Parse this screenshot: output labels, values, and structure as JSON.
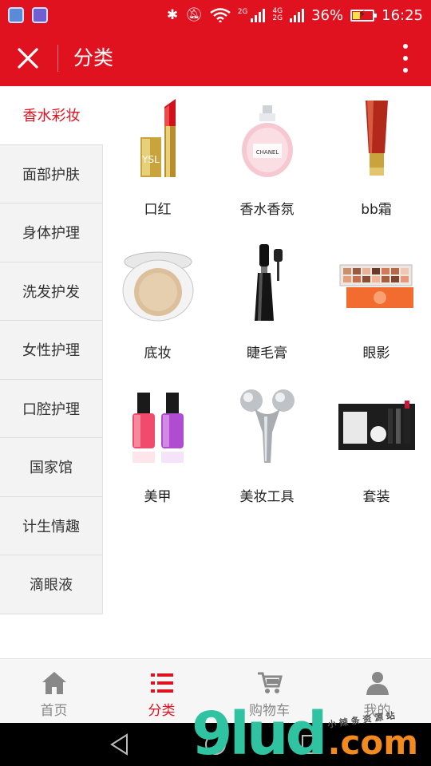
{
  "status_bar": {
    "battery": "36%",
    "time": "16:25",
    "net_top": "4G",
    "net_bottom": "2G",
    "signal_label": "2G",
    "icons": [
      "usb-icon",
      "gallery-icon",
      "bluetooth-icon",
      "mute-icon",
      "wifi-icon",
      "signal-icon",
      "battery-icon"
    ]
  },
  "app_bar": {
    "title": "分类"
  },
  "sidebar": {
    "items": [
      {
        "label": "香水彩妆"
      },
      {
        "label": "面部护肤"
      },
      {
        "label": "身体护理"
      },
      {
        "label": "洗发护发"
      },
      {
        "label": "女性护理"
      },
      {
        "label": "口腔护理"
      },
      {
        "label": "国家馆"
      },
      {
        "label": "计生情趣"
      },
      {
        "label": "滴眼液"
      }
    ],
    "active_index": 0
  },
  "categories": [
    {
      "label": "口红",
      "icon": "lipstick-image"
    },
    {
      "label": "香水香氛",
      "icon": "perfume-image"
    },
    {
      "label": "bb霜",
      "icon": "bb-cream-image"
    },
    {
      "label": "底妆",
      "icon": "cushion-compact-image"
    },
    {
      "label": "睫毛膏",
      "icon": "mascara-image"
    },
    {
      "label": "眼影",
      "icon": "eyeshadow-palette-image"
    },
    {
      "label": "美甲",
      "icon": "nail-polish-image"
    },
    {
      "label": "美妆工具",
      "icon": "face-roller-image"
    },
    {
      "label": "套装",
      "icon": "makeup-set-image"
    }
  ],
  "tab_bar": {
    "tabs": [
      {
        "label": "首页",
        "icon": "home-icon"
      },
      {
        "label": "分类",
        "icon": "list-icon"
      },
      {
        "label": "购物车",
        "icon": "cart-icon"
      },
      {
        "label": "我的",
        "icon": "user-icon"
      }
    ],
    "active_index": 1
  },
  "watermark": {
    "big": "9lud",
    "domain": ".com",
    "small": "小 辣 条 资 源 站"
  },
  "colors": {
    "brand_red": "#e0121f",
    "sidebar_bg": "#f3f3f3",
    "tab_inactive": "#888888"
  }
}
